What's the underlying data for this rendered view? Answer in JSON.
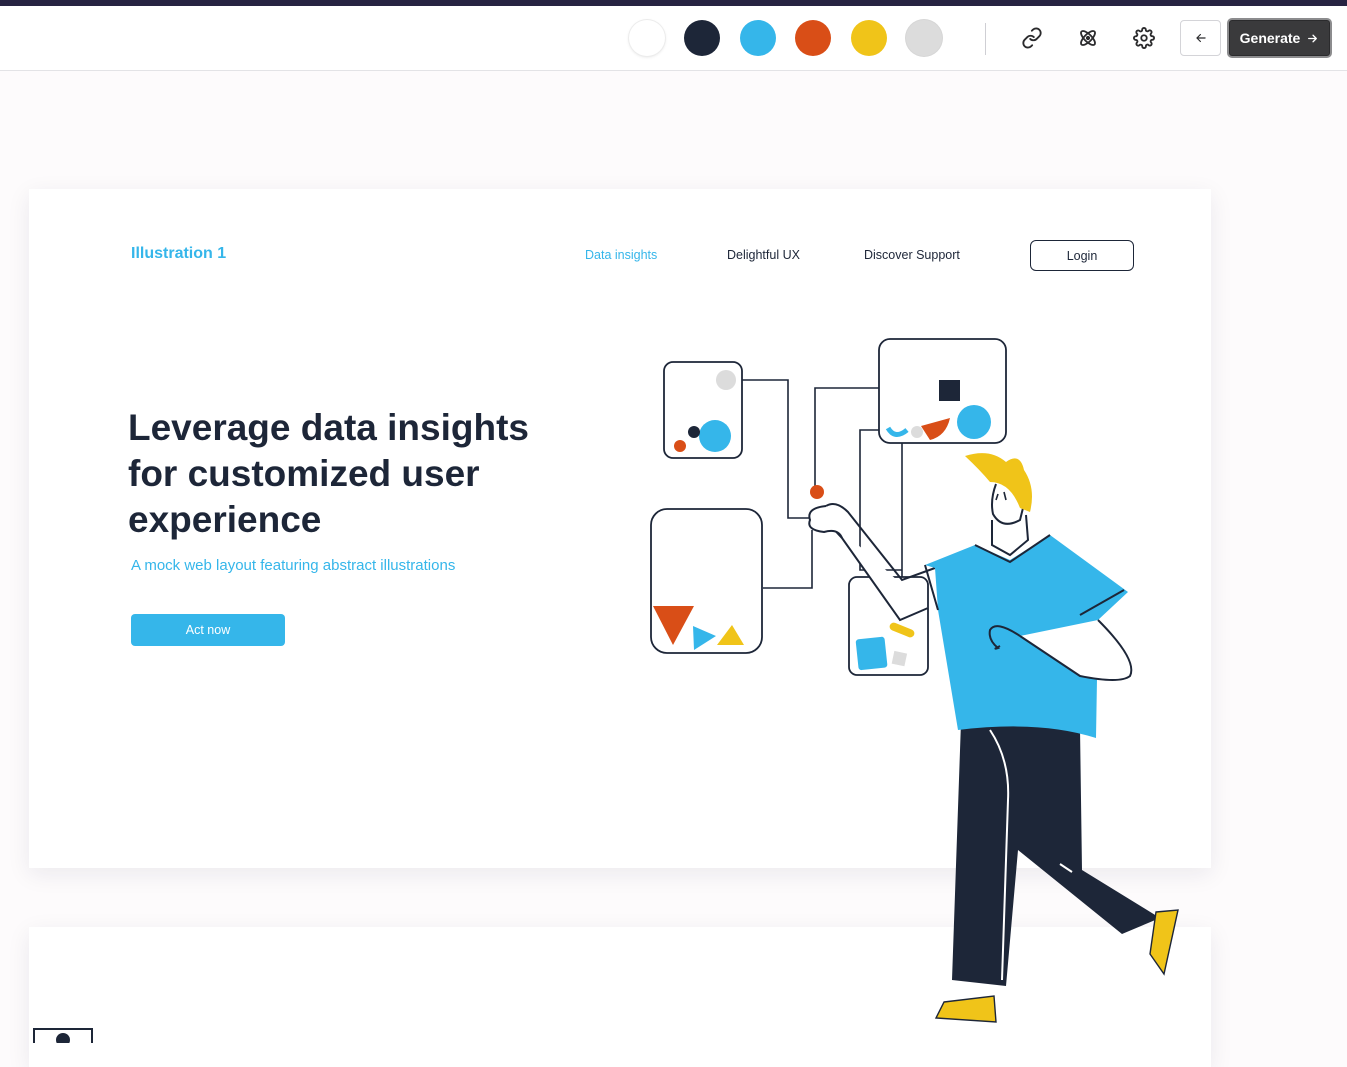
{
  "toolbar": {
    "swatches": [
      {
        "name": "white",
        "color": "#ffffff"
      },
      {
        "name": "navy",
        "color": "#1d2638"
      },
      {
        "name": "sky-blue",
        "color": "#35b6ea"
      },
      {
        "name": "orange",
        "color": "#d94e17"
      },
      {
        "name": "yellow",
        "color": "#f0c419"
      },
      {
        "name": "light-gray",
        "color": "#dcdcdc"
      }
    ],
    "icons": [
      "link-icon",
      "atom-icon",
      "gear-icon"
    ],
    "back_icon": "arrow-left-icon",
    "generate_label": "Generate",
    "generate_icon": "arrow-right-icon"
  },
  "page": {
    "brand": "Illustration 1",
    "nav": [
      {
        "label": "Data insights",
        "active": true
      },
      {
        "label": "Delightful UX",
        "active": false
      },
      {
        "label": "Discover Support",
        "active": false
      }
    ],
    "login_label": "Login",
    "hero": {
      "headline": "Leverage data insights for customized user experience",
      "subline": "A mock web layout featuring abstract illustrations",
      "cta_label": "Act now"
    }
  },
  "colors": {
    "accent": "#35b6ea",
    "navy": "#1d2638",
    "orange": "#d94e17",
    "yellow": "#f0c419",
    "gray": "#dcdcdc",
    "toolbar_strip": "#272342"
  }
}
